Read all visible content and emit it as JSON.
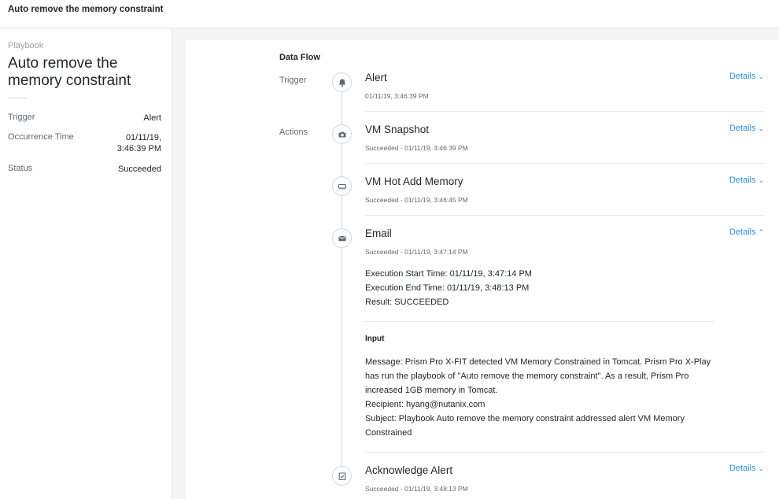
{
  "header": {
    "title": "Auto remove the memory constraint"
  },
  "summary": {
    "eyebrow": "Playbook",
    "heading": "Auto remove the memory constraint",
    "fields": [
      {
        "label": "Trigger",
        "value": "Alert"
      },
      {
        "label": "Occurrence Time",
        "value": "01/11/19, 3:46:39 PM"
      },
      {
        "label": "Status",
        "value": "Succeeded"
      }
    ]
  },
  "flow": {
    "title": "Data Flow",
    "trigger_label": "Trigger",
    "actions_label": "Actions",
    "details_label": "Details",
    "steps": [
      {
        "title": "Alert",
        "sub": "01/11/19, 3:46:39 PM",
        "icon": "bell-icon",
        "expanded": false
      },
      {
        "title": "VM Snapshot",
        "sub": "Succeeded - 01/11/19, 3:46:39 PM",
        "icon": "camera-icon",
        "expanded": false
      },
      {
        "title": "VM Hot Add Memory",
        "sub": "Succeeded - 01/11/19, 3:46:45 PM",
        "icon": "memory-icon",
        "expanded": false
      },
      {
        "title": "Email",
        "sub": "Succeeded - 01/11/19, 3:47:14 PM",
        "icon": "envelope-icon",
        "expanded": true
      },
      {
        "title": "Acknowledge Alert",
        "sub": "Succeeded - 01/11/19, 3:48:13 PM",
        "icon": "check-clipboard-icon",
        "expanded": false
      }
    ],
    "email_details": {
      "execution_start": "Execution Start Time: 01/11/19, 3:47:14 PM",
      "execution_end": "Execution End Time: 01/11/19, 3:48:13 PM",
      "result": "Result: SUCCEEDED",
      "input_label": "Input",
      "message": "Message: Prism Pro X-FIT detected VM Memory Constrained in Tomcat.  Prism Pro X-Play has run the playbook of \"Auto remove the memory constraint\". As a result, Prism Pro increased 1GB memory in Tomcat.",
      "recipient": "Recipient: hyang@nutanix.com",
      "subject": "Subject: Playbook Auto remove the memory constraint addressed alert VM Memory Constrained"
    }
  },
  "colors": {
    "link": "#2b8fd6",
    "text": "#22272e",
    "muted": "#5f6a75",
    "page_bg": "#f3f4f6"
  }
}
